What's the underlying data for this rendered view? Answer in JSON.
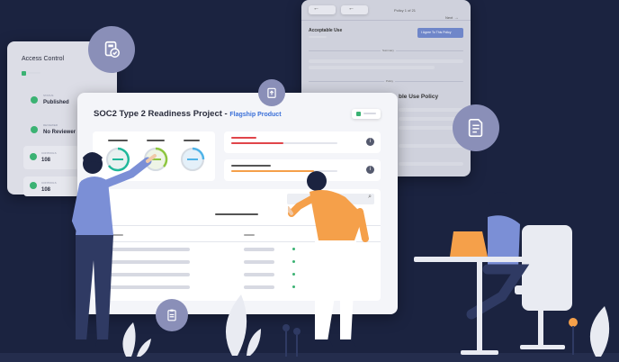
{
  "access_control": {
    "title": "Access Control",
    "items": [
      {
        "label": "STATUS",
        "value": "Published"
      },
      {
        "label": "REVIEWER",
        "value": "No Reviewer"
      },
      {
        "label": "CONTROLS",
        "value": "108"
      },
      {
        "label": "CONTROLS",
        "value": "108"
      }
    ]
  },
  "policy_panel": {
    "nav_label": "Policy 1 of 21",
    "next_label": "Next",
    "title": "Acceptable Use",
    "agree_button": "I Agree To This Policy",
    "section_summary": "Summary",
    "section_policy": "Policy",
    "policy_heading_fragment": "ble Use Policy"
  },
  "project": {
    "title": "SOC2 Type 2 Readiness Project -",
    "product": "Flagship Product"
  },
  "colors": {
    "background": "#1b2340",
    "accent_blue": "#3a6fd8",
    "red_bar": "#e0454a",
    "orange_bar": "#f5a04a",
    "gauge_teal": "#1fb89a",
    "gauge_green": "#8dc63f",
    "gauge_blue": "#4fb3e8",
    "check_green": "#3bb273",
    "icon_circle": "#8a8fb8"
  },
  "icons": {
    "access_badge": "shield-check-icon",
    "upload": "upload-icon",
    "document": "document-icon",
    "clipboard": "clipboard-icon",
    "info": "info-icon"
  }
}
